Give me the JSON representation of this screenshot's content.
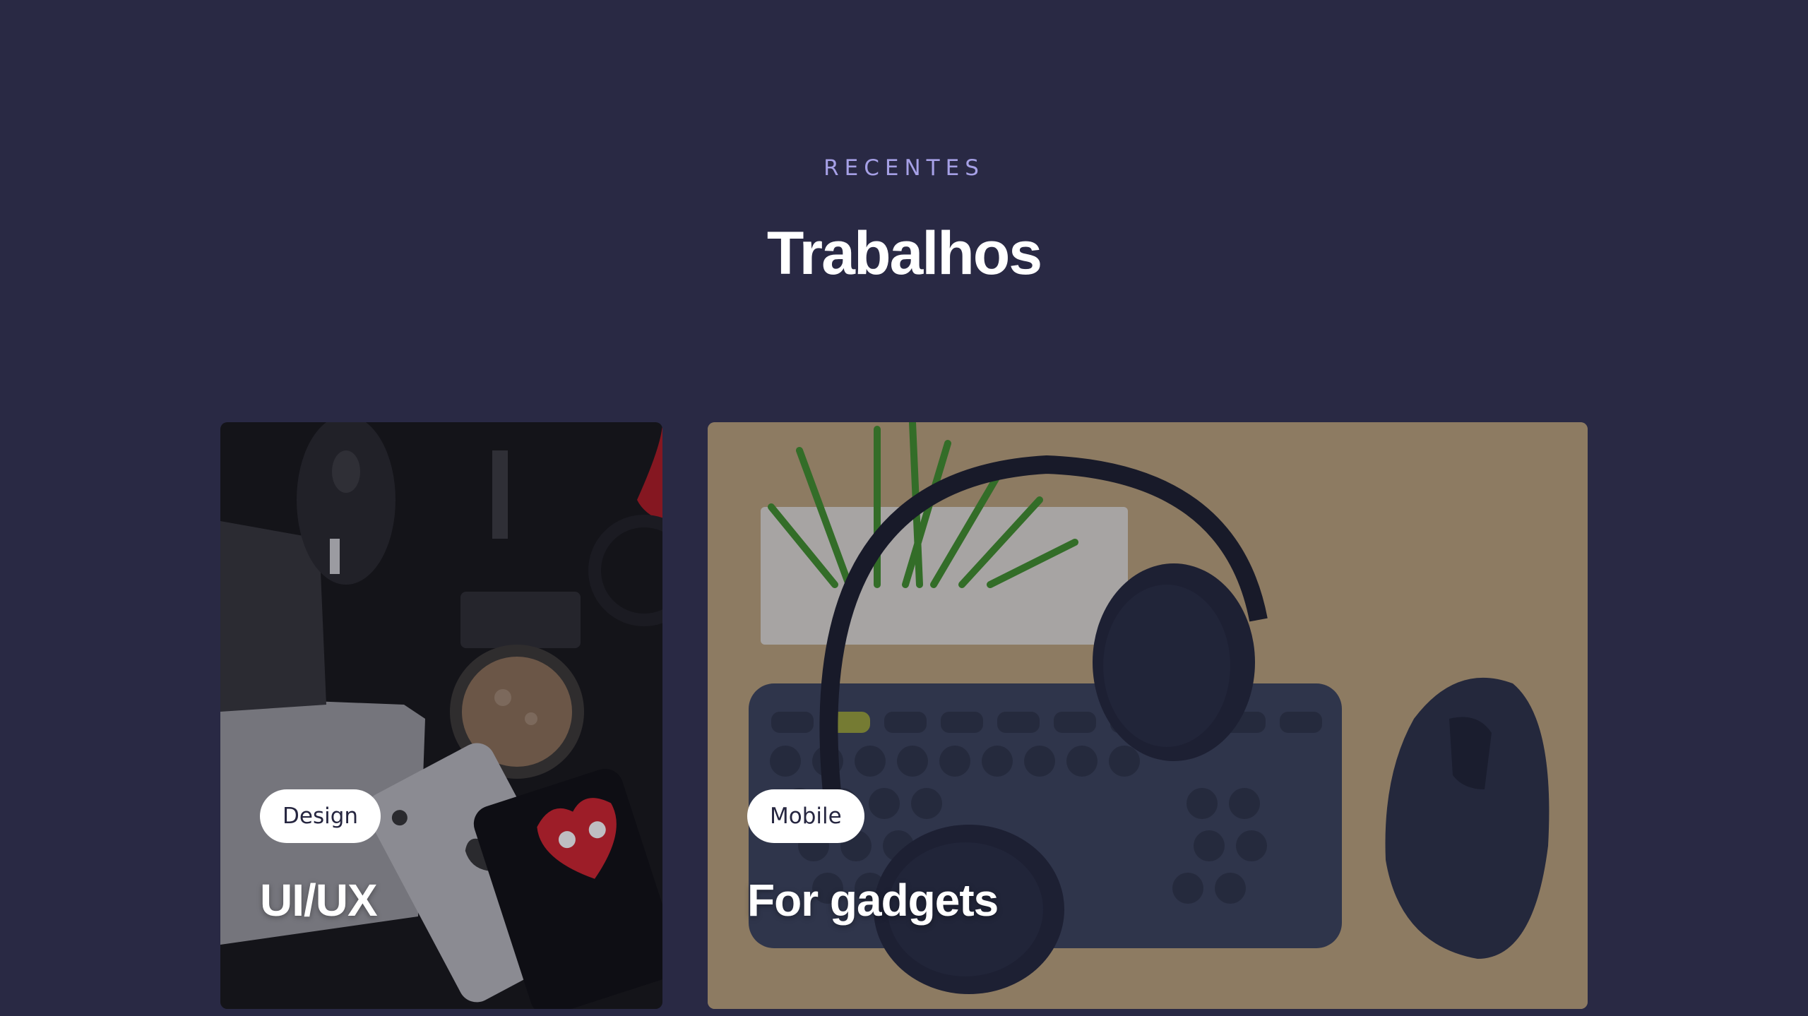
{
  "section": {
    "eyebrow": "RECENTES",
    "title": "Trabalhos"
  },
  "projects": [
    {
      "tag": "Design",
      "title": "UI/UX",
      "image_subject": "flat-lay of phone, mouse, coffee and laptop on dark desk"
    },
    {
      "tag": "Mobile",
      "title": "For gadgets",
      "image_subject": "headphones, keyboard, mouse and plant on wooden desk"
    }
  ],
  "colors": {
    "background": "#292944",
    "eyebrow": "#a6a0e6",
    "title": "#ffffff",
    "tag_bg": "#ffffff",
    "tag_text": "#262640"
  }
}
